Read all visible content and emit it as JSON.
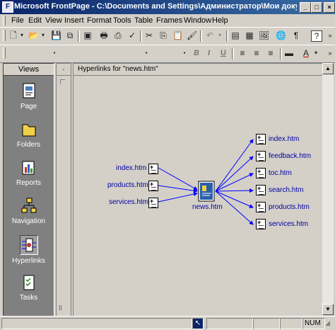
{
  "window": {
    "title": "Microsoft FrontPage - C:\\Documents and Settings\\Администратор\\Мои докумен...",
    "minimize": "_",
    "maximize": "□",
    "close": "×"
  },
  "menu": [
    "File",
    "Edit",
    "View",
    "Insert",
    "Format",
    "Tools",
    "Table",
    "Frames",
    "Window",
    "Help"
  ],
  "views_panel": {
    "header": "Views",
    "items": [
      "Page",
      "Folders",
      "Reports",
      "Navigation",
      "Hyperlinks",
      "Tasks"
    ],
    "selected": "Hyperlinks"
  },
  "hyperlinks": {
    "header": "Hyperlinks for \"news.htm\"",
    "center": "news.htm",
    "incoming": [
      "index.htm",
      "products.htm",
      "services.htm"
    ],
    "outgoing": [
      "index.htm",
      "feedback.htm",
      "toc.htm",
      "search.htm",
      "products.htm",
      "services.htm"
    ]
  },
  "status": {
    "num": "NUM"
  },
  "colors": {
    "title_start": "#0a246a",
    "title_end": "#3a6ea5",
    "link": "#0000a0",
    "arrow": "#0000ff"
  }
}
